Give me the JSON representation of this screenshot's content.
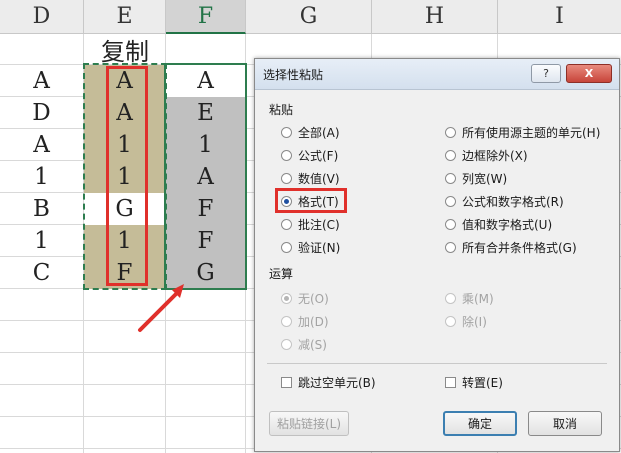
{
  "spreadsheet": {
    "columns": [
      "D",
      "E",
      "F",
      "G",
      "H",
      "I"
    ],
    "copy_label": "复制",
    "col_d": [
      "A",
      "D",
      "A",
      "1",
      "B",
      "1",
      "C"
    ],
    "col_e": [
      "A",
      "A",
      "1",
      "1",
      "G",
      "1",
      "F"
    ],
    "col_f": [
      "A",
      "E",
      "1",
      "A",
      "F",
      "F",
      "G"
    ],
    "colors": {
      "tan": "#c5bc98",
      "gray": "#c0c0c0",
      "marquee": "#2e7d4f",
      "highlight": "#e0302b"
    }
  },
  "dialog": {
    "title": "选择性粘贴",
    "help_btn": "?",
    "close_btn": "X",
    "paste_section": "粘贴",
    "paste_left": [
      "全部(A)",
      "公式(F)",
      "数值(V)",
      "格式(T)",
      "批注(C)",
      "验证(N)"
    ],
    "paste_right": [
      "所有使用源主题的单元(H)",
      "边框除外(X)",
      "列宽(W)",
      "公式和数字格式(R)",
      "值和数字格式(U)",
      "所有合并条件格式(G)"
    ],
    "selected_paste": "格式(T)",
    "operation_section": "运算",
    "op_left": [
      "无(O)",
      "加(D)",
      "减(S)"
    ],
    "op_right": [
      "乘(M)",
      "除(I)"
    ],
    "skip_blanks": "跳过空单元(B)",
    "transpose": "转置(E)",
    "paste_link": "粘贴链接(L)",
    "ok": "确定",
    "cancel": "取消"
  }
}
